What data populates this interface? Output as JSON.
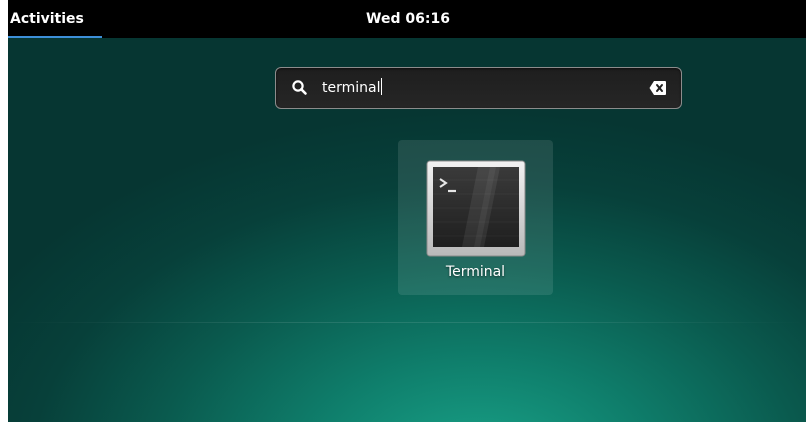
{
  "topbar": {
    "activities_label": "Activities",
    "clock": "Wed 06:16"
  },
  "search": {
    "value": "terminal",
    "icon": "search-icon",
    "clear_icon": "clear-text-icon"
  },
  "results": [
    {
      "label": "Terminal",
      "icon": "terminal-icon"
    }
  ],
  "colors": {
    "topbar": "#000000",
    "accent_underline": "#3d8fd8",
    "background_center": "#1aa58a",
    "background_edge": "#063632"
  }
}
